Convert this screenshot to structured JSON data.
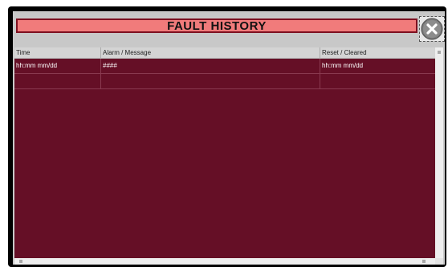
{
  "dialog": {
    "title": "FAULT HISTORY",
    "close_icon": "close-x-icon"
  },
  "table": {
    "columns": [
      "Time",
      "Alarm / Message",
      "Reset / Cleared"
    ],
    "rows": [
      [
        "hh:mm mm/dd",
        "####",
        "hh:mm mm/dd"
      ],
      [
        "",
        "",
        ""
      ]
    ]
  },
  "colors": {
    "title_fill": "#f17b7b",
    "title_border": "#7e1020",
    "table_background": "#650f26",
    "close_button": "#7a7a7a"
  }
}
